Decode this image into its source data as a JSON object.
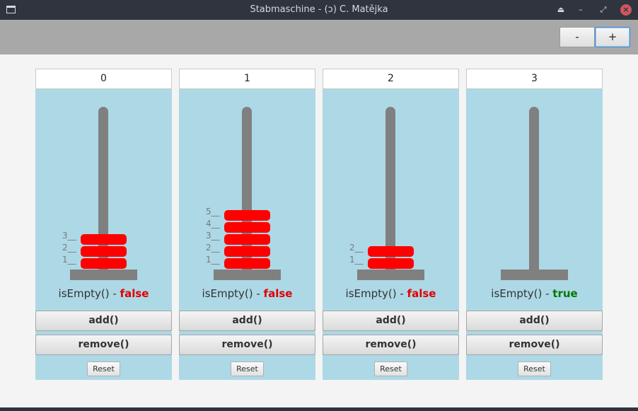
{
  "window": {
    "title": "Stabmaschine - (ɔ) C. Matějka"
  },
  "window_controls": {
    "eject": "⏏",
    "minimize": "–",
    "maximize": "⤢",
    "close": "×"
  },
  "toolbar": {
    "minus_label": "-",
    "plus_label": "+"
  },
  "columns": [
    {
      "index": "0",
      "levels": [
        "3__",
        "2__",
        "1__"
      ],
      "status_prefix": "isEmpty() - ",
      "status_value": "false",
      "add_label": "add()",
      "remove_label": "remove()",
      "reset_label": "Reset"
    },
    {
      "index": "1",
      "levels": [
        "5__",
        "4__",
        "3__",
        "2__",
        "1__"
      ],
      "status_prefix": "isEmpty() - ",
      "status_value": "false",
      "add_label": "add()",
      "remove_label": "remove()",
      "reset_label": "Reset"
    },
    {
      "index": "2",
      "levels": [
        "2__",
        "1__"
      ],
      "status_prefix": "isEmpty() - ",
      "status_value": "false",
      "add_label": "add()",
      "remove_label": "remove()",
      "reset_label": "Reset"
    },
    {
      "index": "3",
      "levels": [],
      "status_prefix": "isEmpty() - ",
      "status_value": "true",
      "add_label": "add()",
      "remove_label": "remove()",
      "reset_label": "Reset"
    }
  ],
  "colors": {
    "disc": "#ff0000",
    "rod": "#808080",
    "panel": "#add8e6",
    "false": "#e00000",
    "true": "#007a00"
  }
}
